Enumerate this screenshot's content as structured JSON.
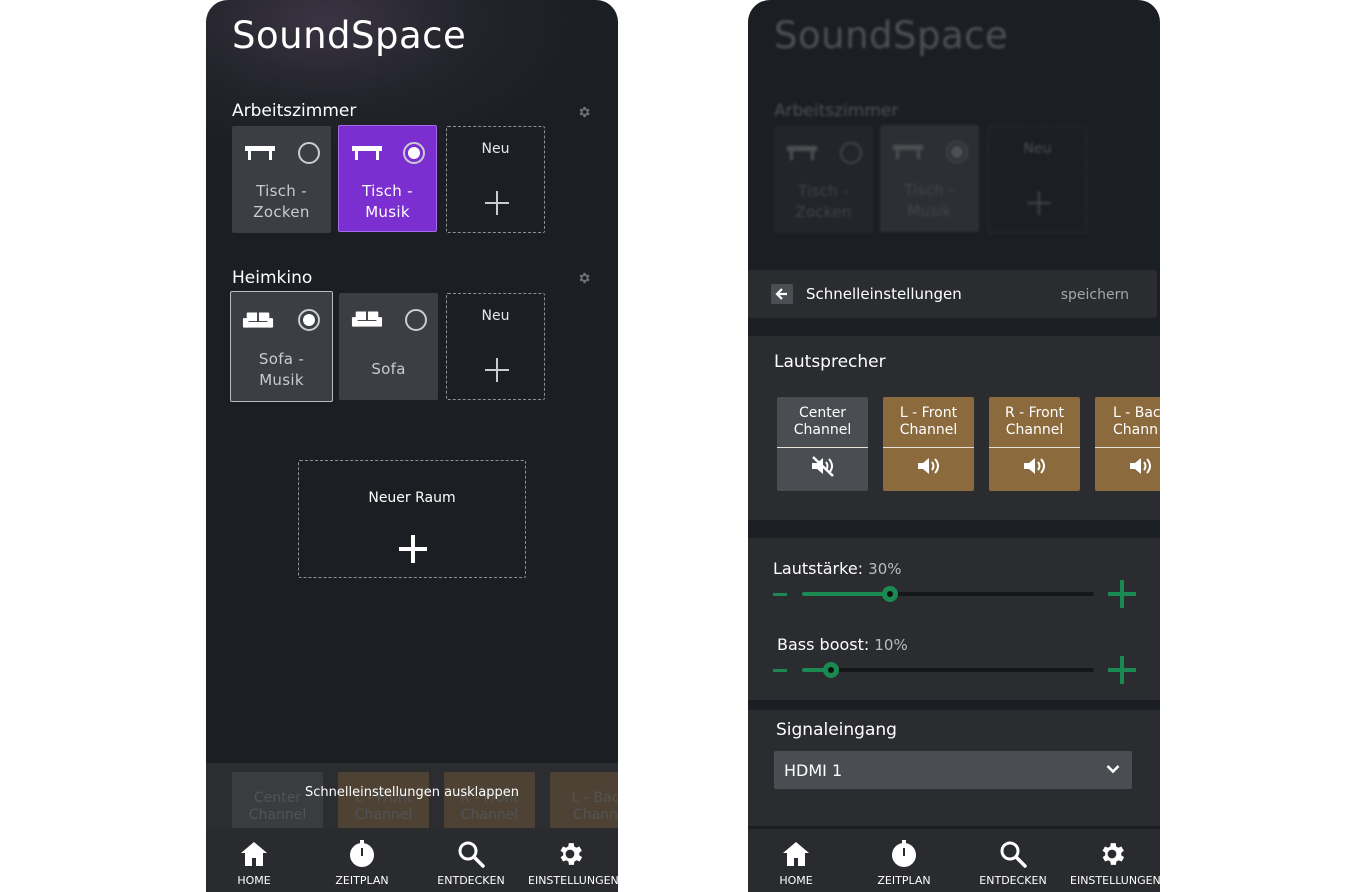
{
  "app": {
    "title": "SoundSpace"
  },
  "rooms": [
    {
      "name": "Arbeitszimmer",
      "devices": [
        {
          "name": "Tisch -\nZocken",
          "icon": "table-icon",
          "selected": false
        },
        {
          "name": "Tisch -\nMusik",
          "icon": "table-icon",
          "selected": true
        }
      ],
      "new_label": "Neu"
    },
    {
      "name": "Heimkino",
      "devices": [
        {
          "name": "Sofa -\nMusik",
          "icon": "sofa-icon",
          "selected": true
        },
        {
          "name": "Sofa",
          "icon": "sofa-icon",
          "selected": false
        }
      ],
      "new_label": "Neu"
    }
  ],
  "new_room": {
    "label": "Neuer Raum"
  },
  "quick_settings_peek": {
    "label": "Schnelleinstellungen ausklappen",
    "cards": [
      "Center\nChannel",
      "L - Front\nChannel",
      "R - Front\nChannel",
      "L - Bac\nChann"
    ]
  },
  "quick_settings": {
    "title": "Schnelleinstellungen",
    "save_label": "speichern",
    "speakers_title": "Lautsprecher",
    "speakers": [
      {
        "name": "Center\nChannel",
        "muted": true
      },
      {
        "name": "L - Front\nChannel",
        "muted": false
      },
      {
        "name": "R - Front\nChannel",
        "muted": false
      },
      {
        "name": "L - Bac\nChann",
        "muted": false
      }
    ],
    "volume": {
      "label": "Lautstärke:",
      "value_text": "30%",
      "value": 0.3
    },
    "bass": {
      "label": "Bass boost:",
      "value_text": "10%",
      "value": 0.1
    },
    "signal": {
      "title": "Signaleingang",
      "selected": "HDMI 1"
    }
  },
  "nav": [
    {
      "label": "HOME",
      "icon": "home-icon"
    },
    {
      "label": "ZEITPLAN",
      "icon": "timer-icon"
    },
    {
      "label": "ENTDECKEN",
      "icon": "search-icon"
    },
    {
      "label": "EINSTELLUNGEN",
      "icon": "gear-icon"
    }
  ],
  "colors": {
    "accent_purple": "#7b2fd0",
    "accent_green": "#1b8a52",
    "speaker_active": "#8b6b3e",
    "background": "#1b1f23"
  }
}
